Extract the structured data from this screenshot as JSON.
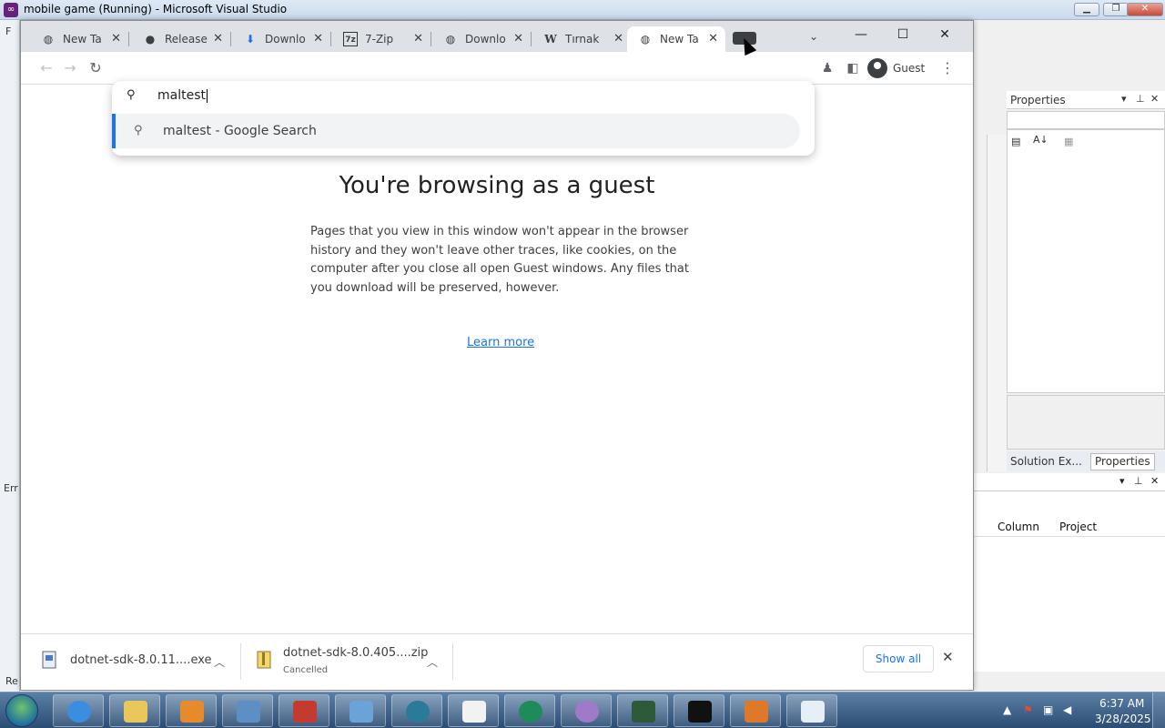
{
  "vs": {
    "title": "mobile game (Running) - Microsoft Visual Studio",
    "menu_stub": "F",
    "properties_title": "Properties",
    "tab_solution": "Solution Ex...",
    "tab_properties": "Properties",
    "error_stub": "Err",
    "ready_stub": "Re",
    "columns": [
      "Column",
      "Project"
    ]
  },
  "chrome": {
    "tabs": [
      {
        "label": "New Ta",
        "icon": "globe-icon"
      },
      {
        "label": "Release",
        "icon": "github-icon"
      },
      {
        "label": "Downlo",
        "icon": "download-icon"
      },
      {
        "label": "7-Zip",
        "icon": "7zip-icon"
      },
      {
        "label": "Downlo",
        "icon": "globe-icon"
      },
      {
        "label": "Tırnak",
        "icon": "wikipedia-icon"
      },
      {
        "label": "New Ta",
        "icon": "globe-icon",
        "active": true
      }
    ],
    "omnibox": {
      "typed": "maltest",
      "suggestion": "maltest - Google Search"
    },
    "profile": "Guest",
    "content": {
      "title": "You're browsing as a guest",
      "body": "Pages that you view in this window won't appear in the browser history and they won't leave other traces, like cookies, on the computer after you close all open Guest windows. Any files that you download will be preserved, however.",
      "link": "Learn more"
    },
    "downloads": [
      {
        "name": "dotnet-sdk-8.0.11....exe",
        "status": ""
      },
      {
        "name": "dotnet-sdk-8.0.405....zip",
        "status": "Cancelled"
      }
    ],
    "show_all": "Show all"
  },
  "taskbar": {
    "time": "6:37 AM",
    "date": "3/28/2025"
  },
  "colors": {
    "accent": "#1a73e8",
    "tabstrip": "#dee1e6"
  }
}
